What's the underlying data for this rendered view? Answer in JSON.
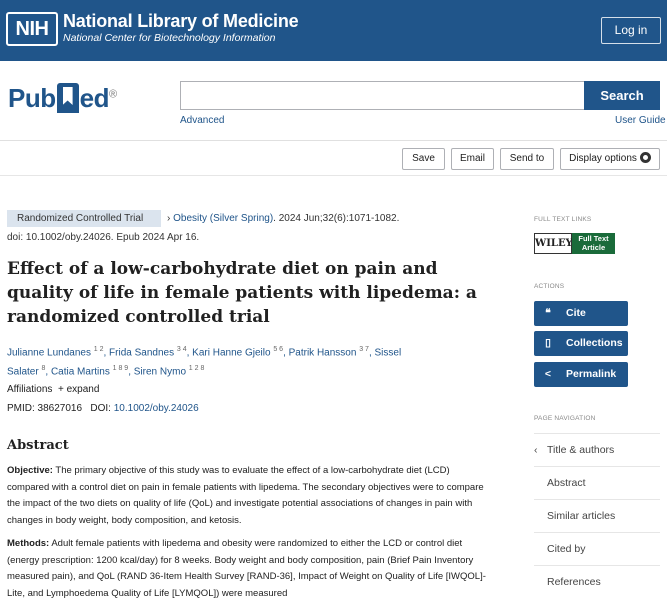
{
  "nih": {
    "logo": "NIH",
    "title": "National Library of Medicine",
    "subtitle": "National Center for Biotechnology Information",
    "login": "Log in"
  },
  "pubmed": {
    "logo_left": "Pub",
    "logo_right": "ed",
    "search_value": "",
    "search_button": "Search",
    "advanced": "Advanced",
    "user_guide": "User Guide"
  },
  "actions": {
    "save": "Save",
    "email": "Email",
    "send_to": "Send to",
    "display_options": "Display options"
  },
  "article": {
    "type_badge": "Randomized Controlled Trial",
    "journal": "Obesity (Silver Spring)",
    "citation": ". 2024 Jun;32(6):1071-1082.",
    "doi_line": "doi: 10.1002/oby.24026. Epub 2024 Apr 16.",
    "title": "Effect of a low-carbohydrate diet on pain and quality of life in female patients with lipedema: a randomized controlled trial",
    "authors": [
      {
        "name": "Julianne Lundanes",
        "sup": "1 2"
      },
      {
        "name": "Frida Sandnes",
        "sup": "3 4"
      },
      {
        "name": "Kari Hanne Gjeilo",
        "sup": "5 6"
      },
      {
        "name": "Patrik Hansson",
        "sup": "3 7"
      },
      {
        "name": "Sissel Salater",
        "sup": "8"
      },
      {
        "name": "Catia Martins",
        "sup": "1 8 9"
      },
      {
        "name": "Siren Nymo",
        "sup": "1 2 8"
      }
    ],
    "affiliations_label": "Affiliations",
    "expand_label": "expand",
    "pmid_label": "PMID: 38627016",
    "doi_label": "DOI:",
    "doi_value": "10.1002/oby.24026",
    "abstract_heading": "Abstract",
    "objective_label": "Objective:",
    "objective_text": "The primary objective of this study was to evaluate the effect of a low-carbohydrate diet (LCD) compared with a control diet on pain in female patients with lipedema. The secondary objectives were to compare the impact of the two diets on quality of life (QoL) and investigate potential associations of changes in pain with changes in body weight, body composition, and ketosis.",
    "methods_label": "Methods:",
    "methods_text": "Adult female patients with lipedema and obesity were randomized to either the LCD or control diet (energy prescription: 1200 kcal/day) for 8 weeks. Body weight and body composition, pain (Brief Pain Inventory measured pain), and QoL (RAND 36-Item Health Survey [RAND-36], Impact of Weight on Quality of Life [IWQOL]-Lite, and Lymphoedema Quality of Life [LYMQOL]) were measured"
  },
  "sidebar": {
    "full_text_links": "FULL TEXT LINKS",
    "wiley": "WILEY",
    "full_text_article": "Full Text Article",
    "actions_heading": "ACTIONS",
    "cite": "Cite",
    "collections": "Collections",
    "permalink": "Permalink",
    "page_navigation": "PAGE NAVIGATION",
    "nav": [
      "Title & authors",
      "Abstract",
      "Similar articles",
      "Cited by",
      "References"
    ]
  }
}
